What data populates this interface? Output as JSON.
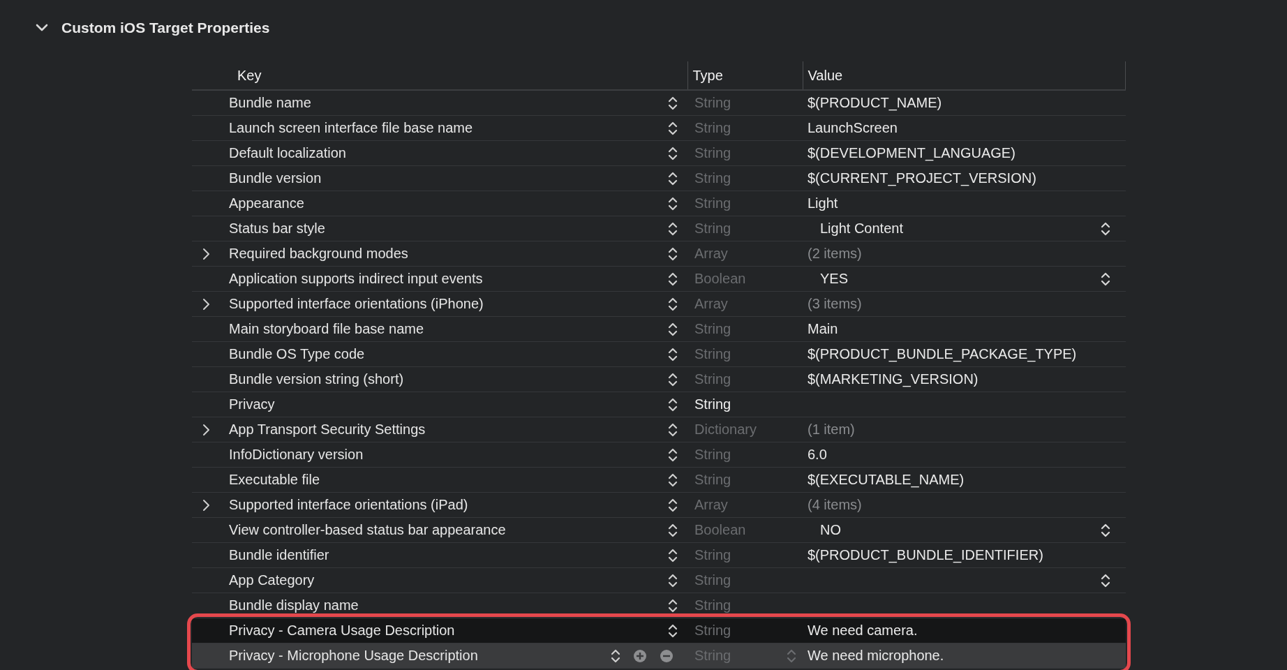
{
  "section": {
    "title": "Custom iOS Target Properties",
    "expanded": true
  },
  "columns": [
    "Key",
    "Type",
    "Value"
  ],
  "rows": [
    {
      "key": "Bundle name",
      "type": "String",
      "type_dim": true,
      "value": "$(PRODUCT_NAME)",
      "value_dim": false,
      "kind": "text",
      "expandable": false,
      "highlighted": false,
      "selected": false
    },
    {
      "key": "Launch screen interface file base name",
      "type": "String",
      "type_dim": true,
      "value": "LaunchScreen",
      "value_dim": false,
      "kind": "text",
      "expandable": false,
      "highlighted": false,
      "selected": false
    },
    {
      "key": "Default localization",
      "type": "String",
      "type_dim": true,
      "value": "$(DEVELOPMENT_LANGUAGE)",
      "value_dim": false,
      "kind": "text",
      "expandable": false,
      "highlighted": false,
      "selected": false
    },
    {
      "key": "Bundle version",
      "type": "String",
      "type_dim": true,
      "value": "$(CURRENT_PROJECT_VERSION)",
      "value_dim": false,
      "kind": "text",
      "expandable": false,
      "highlighted": false,
      "selected": false
    },
    {
      "key": "Appearance",
      "type": "String",
      "type_dim": true,
      "value": "Light",
      "value_dim": false,
      "kind": "text",
      "expandable": false,
      "highlighted": false,
      "selected": false
    },
    {
      "key": "Status bar style",
      "type": "String",
      "type_dim": true,
      "value": "Light Content",
      "value_dim": false,
      "kind": "popup",
      "expandable": false,
      "highlighted": false,
      "selected": false
    },
    {
      "key": "Required background modes",
      "type": "Array",
      "type_dim": true,
      "value": "(2 items)",
      "value_dim": true,
      "kind": "text",
      "expandable": true,
      "highlighted": false,
      "selected": false
    },
    {
      "key": "Application supports indirect input events",
      "type": "Boolean",
      "type_dim": true,
      "value": "YES",
      "value_dim": false,
      "kind": "popup",
      "expandable": false,
      "highlighted": false,
      "selected": false
    },
    {
      "key": "Supported interface orientations (iPhone)",
      "type": "Array",
      "type_dim": true,
      "value": "(3 items)",
      "value_dim": true,
      "kind": "text",
      "expandable": true,
      "highlighted": false,
      "selected": false
    },
    {
      "key": "Main storyboard file base name",
      "type": "String",
      "type_dim": true,
      "value": "Main",
      "value_dim": false,
      "kind": "text",
      "expandable": false,
      "highlighted": false,
      "selected": false
    },
    {
      "key": "Bundle OS Type code",
      "type": "String",
      "type_dim": true,
      "value": "$(PRODUCT_BUNDLE_PACKAGE_TYPE)",
      "value_dim": false,
      "kind": "text",
      "expandable": false,
      "highlighted": false,
      "selected": false
    },
    {
      "key": "Bundle version string (short)",
      "type": "String",
      "type_dim": true,
      "value": "$(MARKETING_VERSION)",
      "value_dim": false,
      "kind": "text",
      "expandable": false,
      "highlighted": false,
      "selected": false
    },
    {
      "key": "Privacy",
      "type": "String",
      "type_dim": false,
      "kind": "text",
      "expandable": false,
      "highlighted": false,
      "selected": false
    },
    {
      "key": "App Transport Security Settings",
      "type": "Dictionary",
      "type_dim": true,
      "value": "(1 item)",
      "value_dim": true,
      "kind": "text",
      "expandable": true,
      "highlighted": false,
      "selected": false
    },
    {
      "key": "InfoDictionary version",
      "type": "String",
      "type_dim": true,
      "value": "6.0",
      "value_dim": false,
      "kind": "text",
      "expandable": false,
      "highlighted": false,
      "selected": false
    },
    {
      "key": "Executable file",
      "type": "String",
      "type_dim": true,
      "value": "$(EXECUTABLE_NAME)",
      "value_dim": false,
      "kind": "text",
      "expandable": false,
      "highlighted": false,
      "selected": false
    },
    {
      "key": "Supported interface orientations (iPad)",
      "type": "Array",
      "type_dim": true,
      "value": "(4 items)",
      "value_dim": true,
      "kind": "text",
      "expandable": true,
      "highlighted": false,
      "selected": false
    },
    {
      "key": "View controller-based status bar appearance",
      "type": "Boolean",
      "type_dim": true,
      "value": "NO",
      "value_dim": false,
      "kind": "popup",
      "expandable": false,
      "highlighted": false,
      "selected": false
    },
    {
      "key": "Bundle identifier",
      "type": "String",
      "type_dim": true,
      "value": "$(PRODUCT_BUNDLE_IDENTIFIER)",
      "value_dim": false,
      "kind": "text",
      "expandable": false,
      "highlighted": false,
      "selected": false
    },
    {
      "key": "App Category",
      "type": "String",
      "type_dim": true,
      "kind": "popup",
      "expandable": false,
      "highlighted": false,
      "selected": false
    },
    {
      "key": "Bundle display name",
      "type": "String",
      "type_dim": true,
      "kind": "text",
      "expandable": false,
      "highlighted": false,
      "selected": false
    },
    {
      "key": "Privacy - Camera Usage Description",
      "type": "String",
      "type_dim": true,
      "value": "We need camera.",
      "value_dim": false,
      "kind": "text",
      "expandable": false,
      "highlighted": true,
      "selected": false
    },
    {
      "key": "Privacy - Microphone Usage Description",
      "type": "String",
      "type_dim": true,
      "value": "We need microphone.",
      "value_dim": false,
      "kind": "text",
      "expandable": false,
      "highlighted": true,
      "selected": true
    }
  ]
}
